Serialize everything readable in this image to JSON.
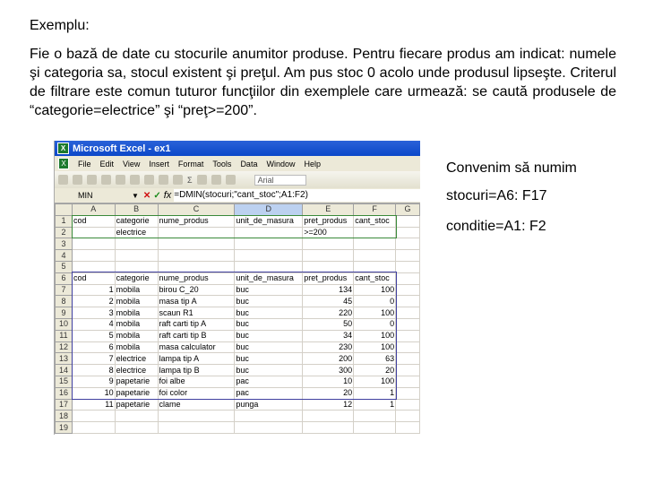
{
  "title": "Exemplu:",
  "paragraph": "Fie o bază de date cu stocurile anumitor produse. Pentru fiecare produs am indicat: numele şi categoria sa, stocul existent şi preţul. Am pus stoc 0 acolo unde produsul lipseşte. Criterul de filtrare este comun tuturor funcţiilor din exemplele care urmează: se caută produsele de “categorie=electrice” şi “preţ>=200”.",
  "notes": [
    "Convenim să numim",
    "stocuri=A6: F17",
    "conditie=A1: F2"
  ],
  "excel": {
    "window_title": "Microsoft Excel - ex1",
    "menu": [
      "File",
      "Edit",
      "View",
      "Insert",
      "Format",
      "Tools",
      "Data",
      "Window",
      "Help"
    ],
    "font_box": "Arial",
    "name_box": "MIN",
    "formula": "=DMIN(stocuri;\"cant_stoc\";A1:F2)",
    "columns": [
      "A",
      "B",
      "C",
      "D",
      "E",
      "F",
      "G"
    ],
    "rows": [
      [
        "cod",
        "categorie",
        "nume_produs",
        "unit_de_masura",
        "pret_produs",
        "cant_stoc"
      ],
      [
        "",
        "electrice",
        "",
        "",
        ">=200",
        ""
      ],
      [],
      [],
      [],
      [
        "cod",
        "categorie",
        "nume_produs",
        "unit_de_masura",
        "pret_produs",
        "cant_stoc"
      ],
      [
        "1",
        "mobila",
        "birou C_20",
        "buc",
        "134",
        "100"
      ],
      [
        "2",
        "mobila",
        "masa tip A",
        "buc",
        "45",
        "0"
      ],
      [
        "3",
        "mobila",
        "scaun R1",
        "buc",
        "220",
        "100"
      ],
      [
        "4",
        "mobila",
        "raft carti tip A",
        "buc",
        "50",
        "0"
      ],
      [
        "5",
        "mobila",
        "raft carti tip B",
        "buc",
        "34",
        "100"
      ],
      [
        "6",
        "mobila",
        "masa calculator",
        "buc",
        "230",
        "100"
      ],
      [
        "7",
        "electrice",
        "lampa tip A",
        "buc",
        "200",
        "63"
      ],
      [
        "8",
        "electrice",
        "lampa tip B",
        "buc",
        "300",
        "20"
      ],
      [
        "9",
        "papetarie",
        "foi albe",
        "pac",
        "10",
        "100"
      ],
      [
        "10",
        "papetarie",
        "foi color",
        "pac",
        "20",
        "1"
      ],
      [
        "11",
        "papetarie",
        "clame",
        "punga",
        "12",
        "1"
      ],
      [],
      []
    ]
  }
}
